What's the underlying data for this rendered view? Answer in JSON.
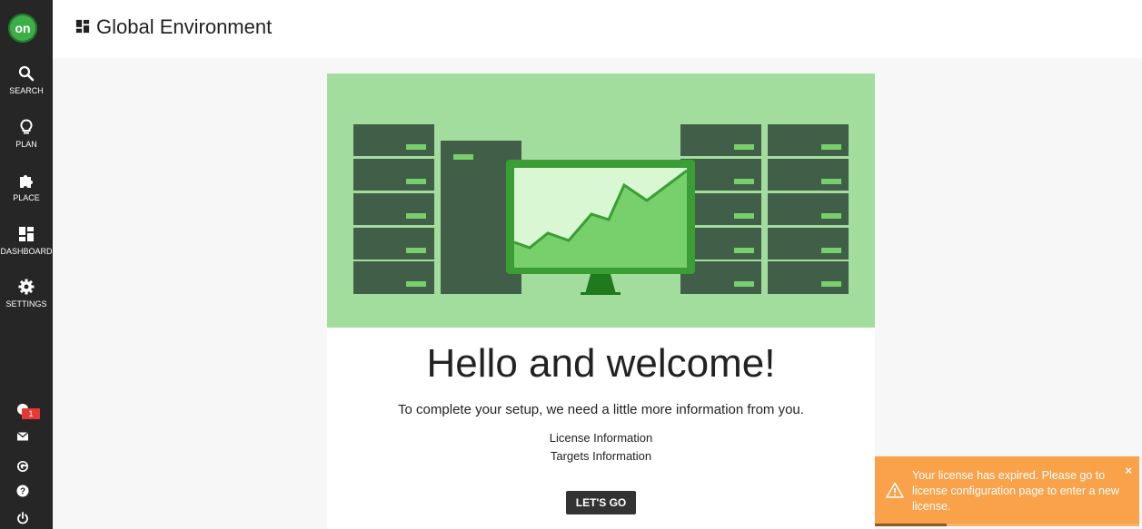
{
  "sidebar": {
    "logo_text": "on",
    "items": [
      {
        "label": "SEARCH",
        "icon": "search-icon"
      },
      {
        "label": "PLAN",
        "icon": "lightbulb-icon"
      },
      {
        "label": "PLACE",
        "icon": "puzzle-icon"
      },
      {
        "label": "DASHBOARD",
        "icon": "dashboard-icon"
      },
      {
        "label": "SETTINGS",
        "icon": "gear-icon"
      }
    ],
    "notification_count": "1",
    "bottom_icons": [
      "notification-icon",
      "mail-icon",
      "google-icon",
      "help-icon",
      "power-icon"
    ]
  },
  "header": {
    "title": "Global Environment",
    "icon": "dashboard-icon"
  },
  "welcome": {
    "heading": "Hello and welcome!",
    "subtitle": "To complete your setup, we need a little more information from you.",
    "steps": [
      "License Information",
      "Targets Information"
    ],
    "button_label": "LET'S GO"
  },
  "toast": {
    "message": "Your license has expired. Please go to license configuration page to enter a new license.",
    "close_label": "×",
    "progress": 0.27,
    "color": "#f9a24a"
  },
  "colors": {
    "sidebar": "#262626",
    "brand_green": "#3fae49",
    "hero_bg": "#a3dd9e",
    "server_dark": "#415e48",
    "server_led": "#77d06b"
  }
}
